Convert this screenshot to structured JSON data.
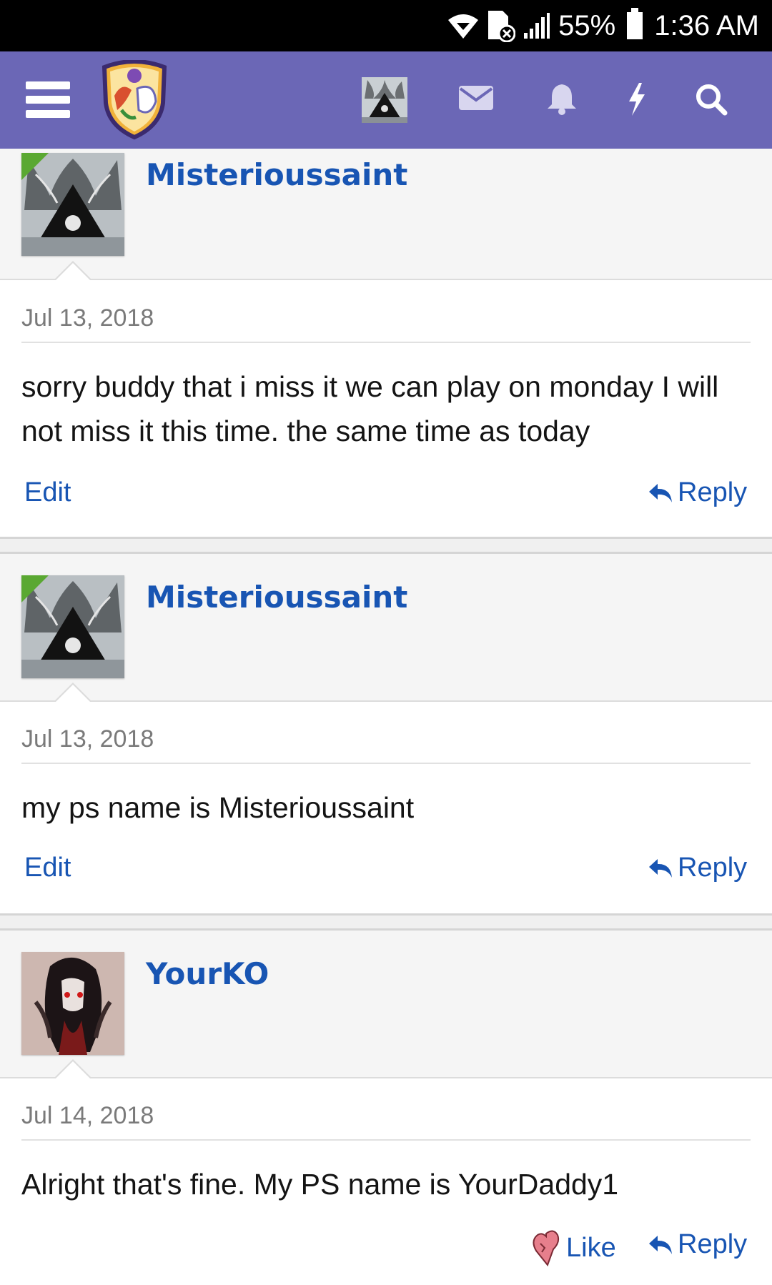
{
  "status_bar": {
    "battery_percent": "55%",
    "time": "1:36 AM",
    "icons": [
      "wifi-icon",
      "no-sim-icon",
      "signal-icon",
      "battery-icon"
    ]
  },
  "header": {
    "icons": [
      "menu-icon",
      "site-logo",
      "user-avatar",
      "mail-icon",
      "bell-icon",
      "lightning-icon",
      "search-icon"
    ],
    "accent_color": "#6b67b6"
  },
  "posts": [
    {
      "username": "Misterioussaint",
      "date": "Jul 13, 2018",
      "text": "sorry buddy that i miss it we can play on monday I will not miss it this time. the same time as today",
      "edit_label": "Edit",
      "reply_label": "Reply"
    },
    {
      "username": "Misterioussaint",
      "date": "Jul 13, 2018",
      "text": "my ps name is Misterioussaint",
      "edit_label": "Edit",
      "reply_label": "Reply"
    },
    {
      "username": "YourKO",
      "date": "Jul 14, 2018",
      "text": "Alright that's fine. My PS name is YourDaddy1",
      "like_label": "Like",
      "reply_label": "Reply"
    }
  ],
  "colors": {
    "link": "#1855b3",
    "online_badge": "#5aa832"
  }
}
